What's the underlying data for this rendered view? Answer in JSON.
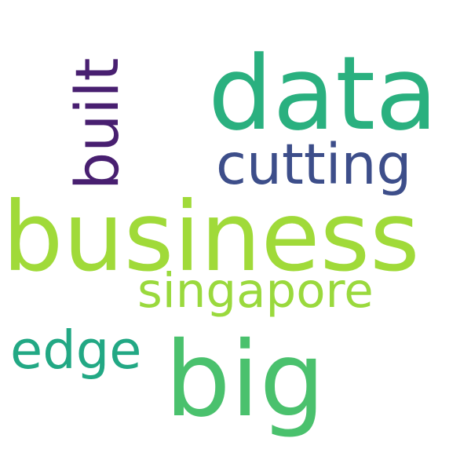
{
  "words": [
    {
      "text": "business",
      "color": "#a0da39"
    },
    {
      "text": "data",
      "color": "#2ab07f"
    },
    {
      "text": "big",
      "color": "#4ac16d"
    },
    {
      "text": "singapore",
      "color": "#9ad93d"
    },
    {
      "text": "cutting",
      "color": "#3d4e8a"
    },
    {
      "text": "edge",
      "color": "#22a884"
    },
    {
      "text": "built",
      "color": "#481f70"
    }
  ]
}
